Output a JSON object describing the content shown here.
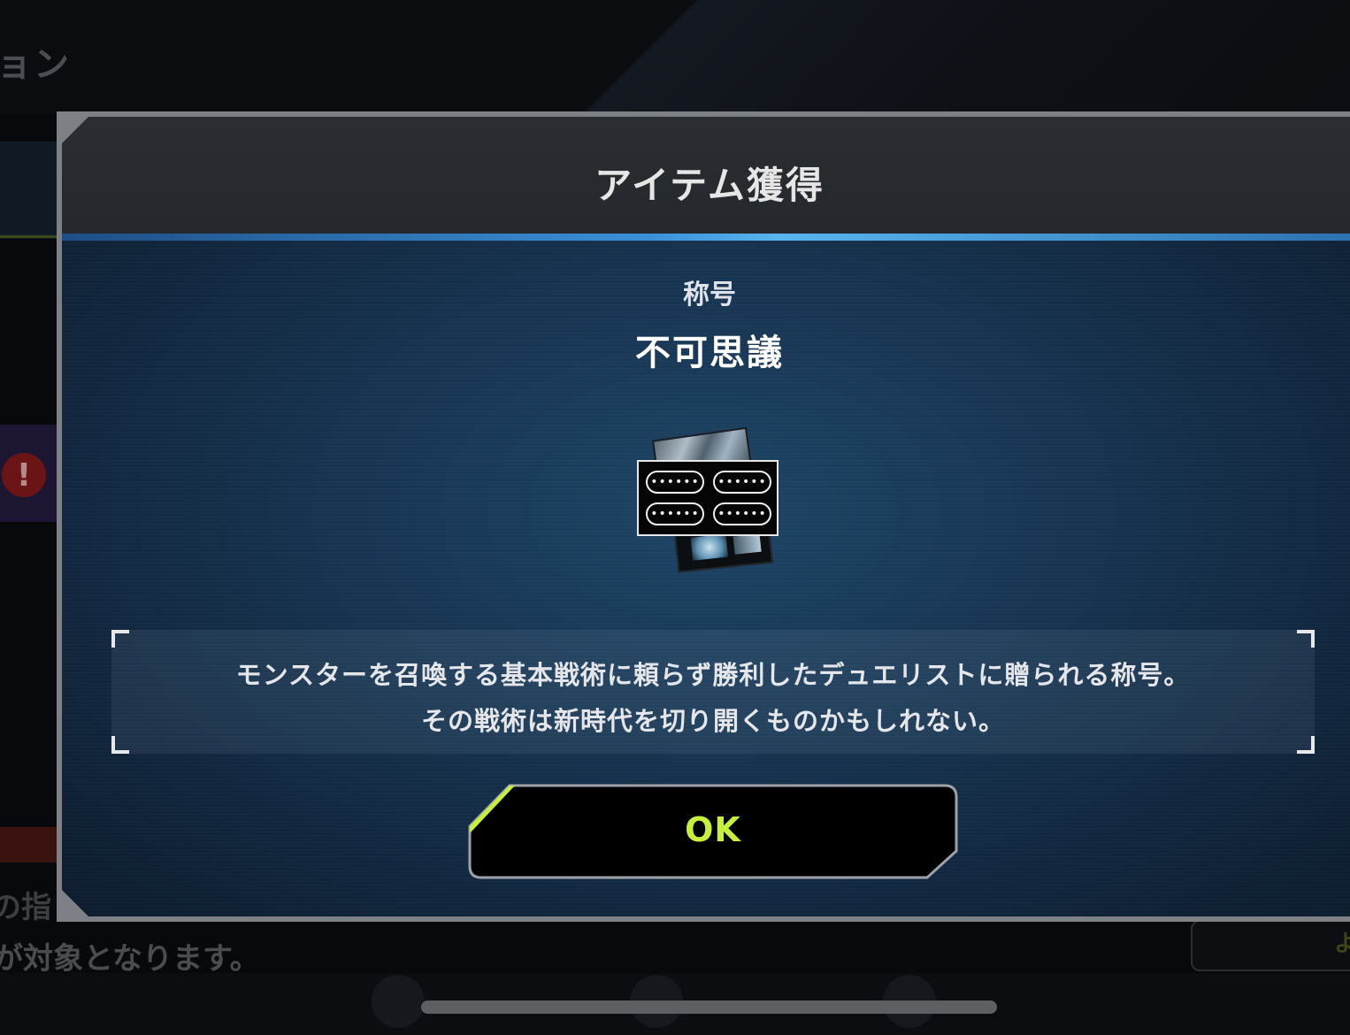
{
  "background": {
    "screen_title_fragment": "ョン",
    "warning_icon": "exclamation-icon",
    "bottom_text_1": "の指",
    "bottom_text_2": "が対象となります。",
    "bottom_button_fragment": "よ"
  },
  "modal": {
    "title": "アイテム獲得",
    "item_category": "称号",
    "item_name": "不可思議",
    "item_icon": "title-badge-icon",
    "icon_pills": [
      "••••••",
      "••••••",
      "••••••",
      "••••••"
    ],
    "description_line_1": "モンスターを召喚する基本戦術に頼らず勝利したデュエリストに贈られる称号。",
    "description_line_2": "その戦術は新時代を切り開くものかもしれない。",
    "ok_button_label": "OK"
  },
  "colors": {
    "accent_green": "#c6f03c",
    "header_divider_blue": "#3a90d8",
    "modal_body": "#16324e"
  }
}
